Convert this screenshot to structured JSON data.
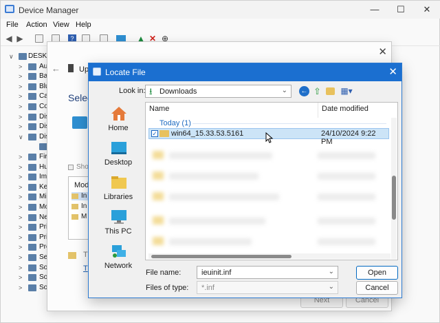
{
  "device_manager": {
    "title": "Device Manager",
    "menu": [
      "File",
      "Action",
      "View",
      "Help"
    ],
    "window_controls": [
      "—",
      "☐",
      "✕"
    ],
    "tree": [
      {
        "arrow": "∨",
        "label": "DESKT"
      },
      {
        "arrow": ">",
        "label": "Au"
      },
      {
        "arrow": ">",
        "label": "Bat"
      },
      {
        "arrow": ">",
        "label": "Blu"
      },
      {
        "arrow": ">",
        "label": "Ca"
      },
      {
        "arrow": ">",
        "label": "Co"
      },
      {
        "arrow": ">",
        "label": "Dis"
      },
      {
        "arrow": ">",
        "label": "Dis"
      },
      {
        "arrow": "∨",
        "label": "Dis"
      },
      {
        "arrow": "",
        "label": ""
      },
      {
        "arrow": ">",
        "label": "Fir"
      },
      {
        "arrow": ">",
        "label": "Hu"
      },
      {
        "arrow": ">",
        "label": "Ima"
      },
      {
        "arrow": ">",
        "label": "Ke"
      },
      {
        "arrow": ">",
        "label": "Mi"
      },
      {
        "arrow": ">",
        "label": "Mo"
      },
      {
        "arrow": ">",
        "label": "Ne"
      },
      {
        "arrow": ">",
        "label": "Pri"
      },
      {
        "arrow": ">",
        "label": "Pri"
      },
      {
        "arrow": ">",
        "label": "Pro"
      },
      {
        "arrow": ">",
        "label": "Sec"
      },
      {
        "arrow": ">",
        "label": "Sof"
      },
      {
        "arrow": ">",
        "label": "So"
      },
      {
        "arrow": ">",
        "label": "So"
      }
    ]
  },
  "wizard": {
    "title_part": "Up",
    "heading": "Selec",
    "show_label": "Sho",
    "list_header": "Mod",
    "list_items": [
      "In",
      "In",
      "M"
    ],
    "tip_text": "T",
    "tip_link": "T",
    "next_label": "Next",
    "cancel_label": "Cancel"
  },
  "dialog": {
    "title": "Locate File",
    "close": "✕",
    "look_in_label": "Look in:",
    "look_in_value": "Downloads",
    "places": [
      {
        "label": "Home",
        "icon": "home-icon"
      },
      {
        "label": "Desktop",
        "icon": "desktop-icon"
      },
      {
        "label": "Libraries",
        "icon": "libraries-icon"
      },
      {
        "label": "This PC",
        "icon": "this-pc-icon"
      },
      {
        "label": "Network",
        "icon": "network-icon"
      }
    ],
    "columns": {
      "name": "Name",
      "date_modified": "Date modified"
    },
    "group": "Today (1)",
    "selected_file": {
      "name": "win64_15.33.53.5161",
      "date": "24/10/2024 9:22 PM"
    },
    "file_name_label": "File name:",
    "file_name_value": "ieuinit.inf",
    "files_of_type_label": "Files of type:",
    "files_of_type_value": "*.inf",
    "open_label": "Open",
    "cancel_label": "Cancel"
  },
  "colors": {
    "accent": "#1b6fd0",
    "selection": "#cce4f7",
    "folder": "#e8c15d"
  }
}
